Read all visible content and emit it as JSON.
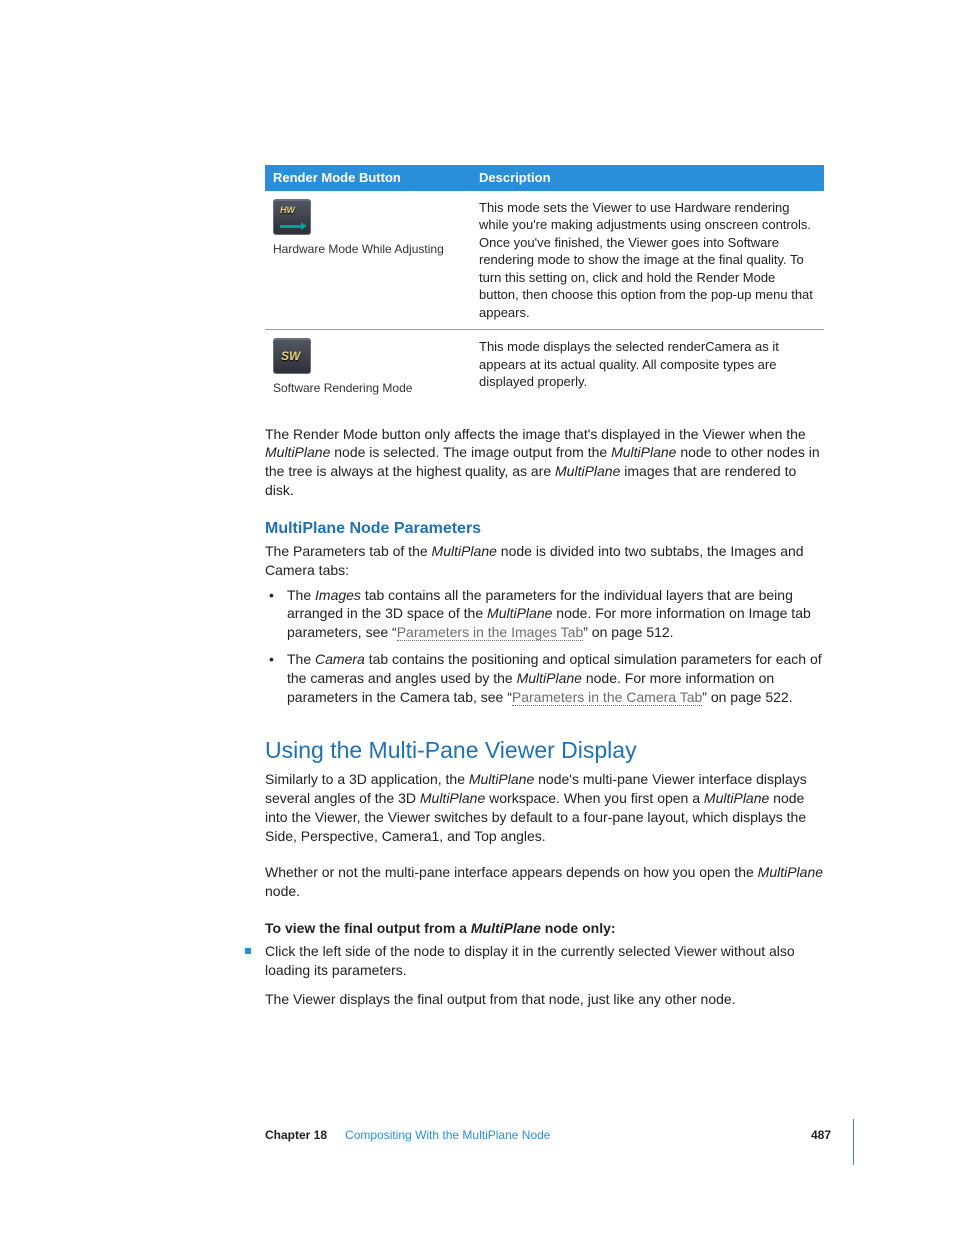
{
  "table": {
    "headers": [
      "Render Mode Button",
      "Description"
    ],
    "rows": [
      {
        "caption": "Hardware Mode While Adjusting",
        "desc": "This mode sets the Viewer to use Hardware rendering while you're making adjustments using onscreen controls. Once you've finished, the Viewer goes into Software rendering mode to show the image at the final quality. To turn this setting on, click and hold the Render Mode button, then choose this option from the pop-up menu that appears."
      },
      {
        "caption": "Software Rendering Mode",
        "desc": "This mode displays the selected renderCamera as it appears at its actual quality. All composite types are displayed properly."
      }
    ]
  },
  "p_rendermode": {
    "a": "The Render Mode button only affects the image that's displayed in the Viewer when the ",
    "b": "MultiPlane",
    "c": " node is selected. The image output from the ",
    "d": "MultiPlane",
    "e": " node to other nodes in the tree is always at the highest quality, as are ",
    "f": "MultiPlane",
    "g": " images that are rendered to disk."
  },
  "h_params": "MultiPlane Node Parameters",
  "p_params": {
    "a": "The Parameters tab of the ",
    "b": "MultiPlane",
    "c": " node is divided into two subtabs, the Images and Camera tabs:"
  },
  "li_images": {
    "a": "The ",
    "b": "Images",
    "c": " tab contains all the parameters for the individual layers that are being arranged in the 3D space of the ",
    "d": "MultiPlane",
    "e": " node. For more information on Image tab parameters, see “",
    "link": "Parameters in the Images Tab",
    "f": "” on page 512."
  },
  "li_camera": {
    "a": "The ",
    "b": "Camera",
    "c": " tab contains the positioning and optical simulation parameters for each of the cameras and angles used by the ",
    "d": "MultiPlane",
    "e": " node. For more information on parameters in the Camera tab, see “",
    "link": "Parameters in the Camera Tab",
    "f": "” on page 522."
  },
  "h_multipane": "Using the Multi-Pane Viewer Display",
  "p_multipane": {
    "a": "Similarly to a 3D application, the ",
    "b": "MultiPlane",
    "c": " node's multi-pane Viewer interface displays several angles of the 3D ",
    "d": "MultiPlane",
    "e": " workspace. When you first open a ",
    "f": "MultiPlane",
    "g": " node into the Viewer, the Viewer switches by default to a four-pane layout, which displays the Side, Perspective, Camera1, and Top angles."
  },
  "p_whether": {
    "a": "Whether or not the multi-pane interface appears depends on how you open the ",
    "b": "MultiPlane",
    "c": " node."
  },
  "task_heading": {
    "a": "To view the final output from a ",
    "b": "MultiPlane",
    "c": " node only:"
  },
  "step1": "Click the left side of the node to display it in the currently selected Viewer without also loading its parameters.",
  "step1_after": "The Viewer displays the final output from that node, just like any other node.",
  "footer": {
    "chapter": "Chapter 18",
    "title": "Compositing With the MultiPlane Node",
    "page": "487"
  }
}
